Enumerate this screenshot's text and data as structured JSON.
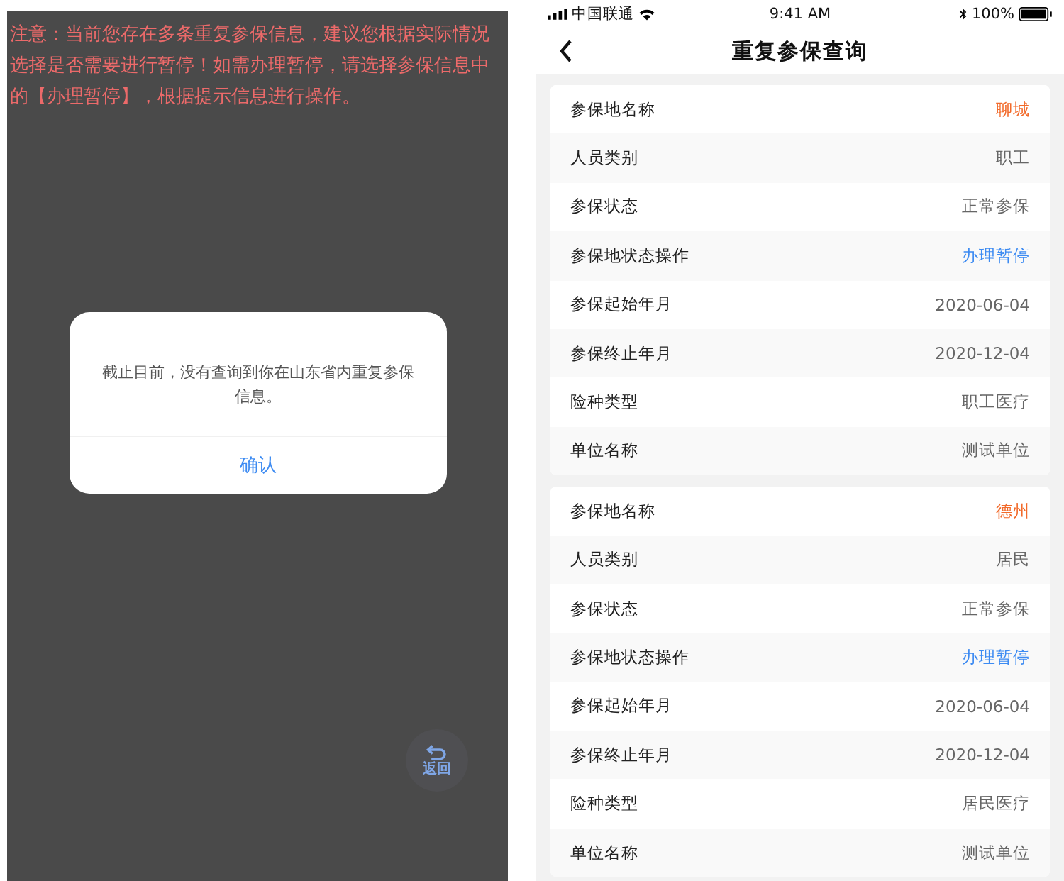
{
  "left_screen": {
    "notice": "注意：当前您存在多条重复参保信息，建议您根据实际情况选择是否需要进行暂停！如需办理暂停，请选择参保信息中的【办理暂停】，根据提示信息进行操作。",
    "dialog": {
      "message": "截止目前，没有查询到你在山东省内重复参保信息。",
      "confirm": "确认"
    },
    "back_button": {
      "label": "返回"
    }
  },
  "right_screen": {
    "status_bar": {
      "carrier": "中国联通",
      "time": "9:41 AM",
      "battery": "100%"
    },
    "nav_bar": {
      "title": "重复参保查询"
    },
    "records": [
      {
        "rows": [
          {
            "label": "参保地名称",
            "value": "聊城",
            "kind": "highlight"
          },
          {
            "label": "人员类别",
            "value": "职工",
            "kind": "plain"
          },
          {
            "label": "参保状态",
            "value": "正常参保",
            "kind": "plain"
          },
          {
            "label": "参保地状态操作",
            "value": "办理暂停",
            "kind": "link"
          },
          {
            "label": "参保起始年月",
            "value": "2020-06-04",
            "kind": "plain"
          },
          {
            "label": "参保终止年月",
            "value": "2020-12-04",
            "kind": "plain"
          },
          {
            "label": "险种类型",
            "value": "职工医疗",
            "kind": "plain"
          },
          {
            "label": "单位名称",
            "value": "测试单位",
            "kind": "plain"
          }
        ]
      },
      {
        "rows": [
          {
            "label": "参保地名称",
            "value": "德州",
            "kind": "highlight"
          },
          {
            "label": "人员类别",
            "value": "居民",
            "kind": "plain"
          },
          {
            "label": "参保状态",
            "value": "正常参保",
            "kind": "plain"
          },
          {
            "label": "参保地状态操作",
            "value": "办理暂停",
            "kind": "link"
          },
          {
            "label": "参保起始年月",
            "value": "2020-06-04",
            "kind": "plain"
          },
          {
            "label": "参保终止年月",
            "value": "2020-12-04",
            "kind": "plain"
          },
          {
            "label": "险种类型",
            "value": "居民医疗",
            "kind": "plain"
          },
          {
            "label": "单位名称",
            "value": "测试单位",
            "kind": "plain"
          }
        ]
      }
    ]
  }
}
